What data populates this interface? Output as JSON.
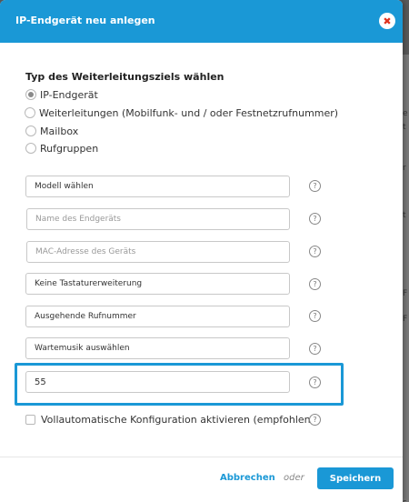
{
  "modal": {
    "title": "IP-Endgerät neu anlegen",
    "close_symbol": "✖"
  },
  "routing": {
    "section_title": "Typ des Weiterleitungsziels wählen",
    "options": [
      {
        "label": "IP-Endgerät",
        "selected": true
      },
      {
        "label": "Weiterleitungen (Mobilfunk- und / oder Festnetzrufnummer)",
        "selected": false
      },
      {
        "label": "Mailbox",
        "selected": false
      },
      {
        "label": "Rufgruppen",
        "selected": false
      }
    ]
  },
  "fields": {
    "model": {
      "value": "Modell wählen"
    },
    "device_name": {
      "placeholder": "Name des Endgeräts"
    },
    "mac_address": {
      "placeholder": "MAC-Adresse des Geräts"
    },
    "keypad_extension": {
      "value": "Keine Tastaturerweiterung"
    },
    "outgoing_number": {
      "value": "Ausgehende Rufnummer"
    },
    "hold_music": {
      "value": "Wartemusik auswählen"
    },
    "number_input": {
      "value": "55"
    }
  },
  "help_symbol": "?",
  "auto_config": {
    "label": "Vollautomatische Konfiguration aktivieren (empfohlen)",
    "checked": false
  },
  "footer": {
    "cancel_label": "Abbrechen",
    "or_label": "oder",
    "save_label": "Speichern"
  },
  "backdrop": {
    "glyphs": [
      "e",
      "t",
      "r",
      "t",
      "F",
      "F",
      "s",
      "s"
    ]
  },
  "colors": {
    "accent": "#1a98d6",
    "close_icon": "#e0321e"
  }
}
